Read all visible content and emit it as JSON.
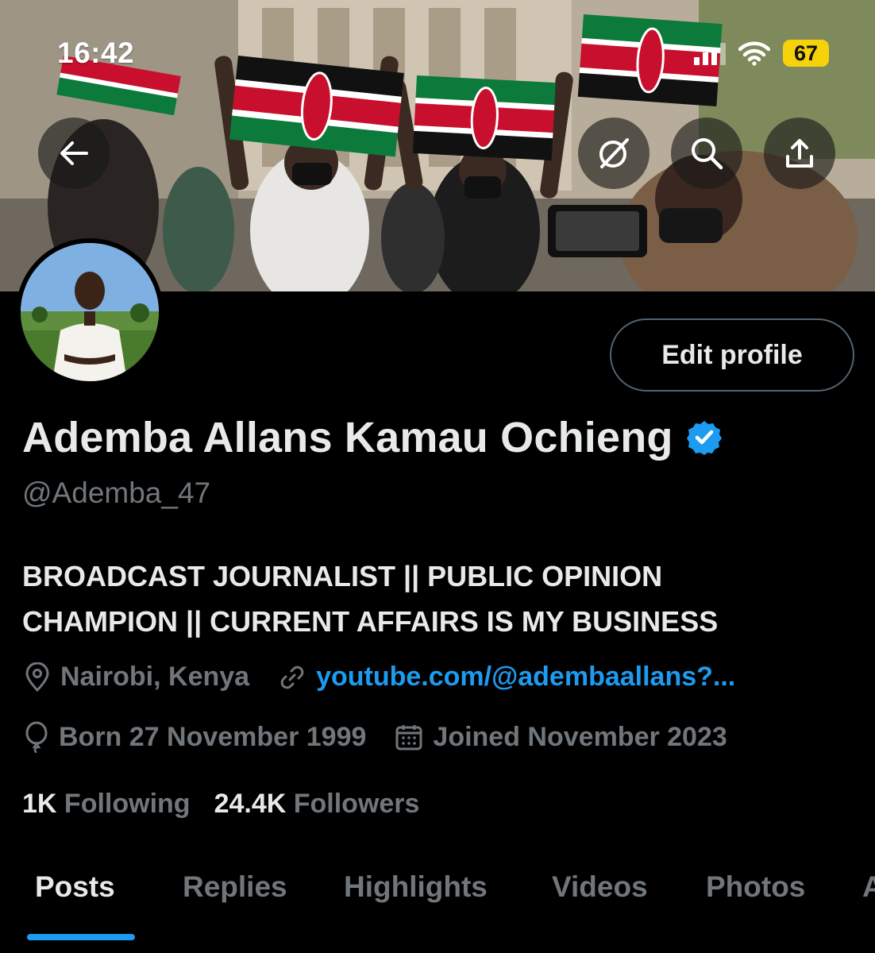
{
  "status_bar": {
    "time": "16:42",
    "battery": "67",
    "icons": [
      "signal-icon",
      "wifi-icon",
      "battery-icon"
    ]
  },
  "header_actions": {
    "back_icon": "arrow-left-icon",
    "grok_icon": "grok-icon",
    "search_icon": "search-icon",
    "share_icon": "share-icon"
  },
  "profile": {
    "edit_button": "Edit profile",
    "name": "Ademba Allans Kamau Ochieng",
    "verified_icon": "verified-badge-icon",
    "handle": "@Ademba_47",
    "bio_line1": "BROADCAST JOURNALIST || PUBLIC OPINION",
    "bio_line2": "CHAMPION || CURRENT AFFAIRS IS MY BUSINESS",
    "location": "Nairobi, Kenya",
    "website": "youtube.com/@ademba​allans?...",
    "born": "Born 27 November 1999",
    "joined": "Joined November 2023",
    "following_count": "1K",
    "following_label": "Following",
    "followers_count": "24.4K",
    "followers_label": "Followers"
  },
  "tabs": [
    {
      "label": "Posts",
      "active": true
    },
    {
      "label": "Replies"
    },
    {
      "label": "Highlights"
    },
    {
      "label": "Videos"
    },
    {
      "label": "Photos"
    },
    {
      "label": "A"
    }
  ],
  "colors": {
    "background": "#000000",
    "accent": "#1d9bf0",
    "muted_text": "#71767b",
    "primary_text": "#e7e9ea",
    "battery": "#f5d20a"
  }
}
